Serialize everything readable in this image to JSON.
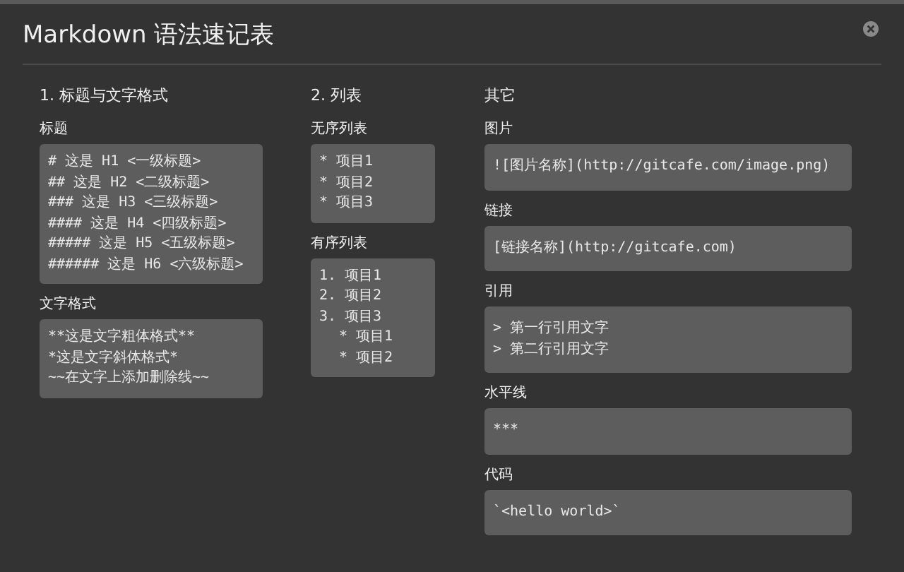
{
  "window": {
    "title": "Markdown 语法速记表"
  },
  "columns": [
    {
      "heading": "1. 标题与文字格式",
      "sections": [
        {
          "label": "标题",
          "lines": [
            {
              "text": "# 这是 H1 <一级标题>"
            },
            {
              "text": "## 这是 H2 <二级标题>"
            },
            {
              "text": "### 这是 H3 <三级标题>"
            },
            {
              "text": "#### 这是 H4 <四级标题>"
            },
            {
              "text": "##### 这是 H5 <五级标题>"
            },
            {
              "text": "###### 这是 H6 <六级标题>"
            }
          ]
        },
        {
          "label": "文字格式",
          "lines": [
            {
              "text": "**这是文字粗体格式**"
            },
            {
              "text": "*这是文字斜体格式*"
            },
            {
              "text": "~~在文字上添加删除线~~"
            }
          ]
        }
      ]
    },
    {
      "heading": "2. 列表",
      "sections": [
        {
          "label": "无序列表",
          "lines": [
            {
              "text": "* 项目1"
            },
            {
              "text": "* 项目2"
            },
            {
              "text": "* 项目3"
            }
          ]
        },
        {
          "label": "有序列表",
          "lines": [
            {
              "text": "1. 项目1"
            },
            {
              "text": "2. 项目2"
            },
            {
              "text": "3. 项目3",
              "children": [
                {
                  "text": "* 项目1"
                },
                {
                  "text": "* 项目2"
                }
              ]
            }
          ]
        }
      ]
    },
    {
      "heading": "其它",
      "sections": [
        {
          "label": "图片",
          "lines": [
            {
              "text": "![图片名称](http://gitcafe.com/image.png)"
            }
          ]
        },
        {
          "label": "链接",
          "lines": [
            {
              "text": "[链接名称](http://gitcafe.com)"
            }
          ]
        },
        {
          "label": "引用",
          "lines": [
            {
              "text": "> 第一行引用文字"
            },
            {
              "text": "> 第二行引用文字"
            }
          ]
        },
        {
          "label": "水平线",
          "lines": [
            {
              "text": "***"
            }
          ]
        },
        {
          "label": "代码",
          "lines": [
            {
              "text": "`<hello world>`"
            }
          ]
        }
      ]
    }
  ]
}
